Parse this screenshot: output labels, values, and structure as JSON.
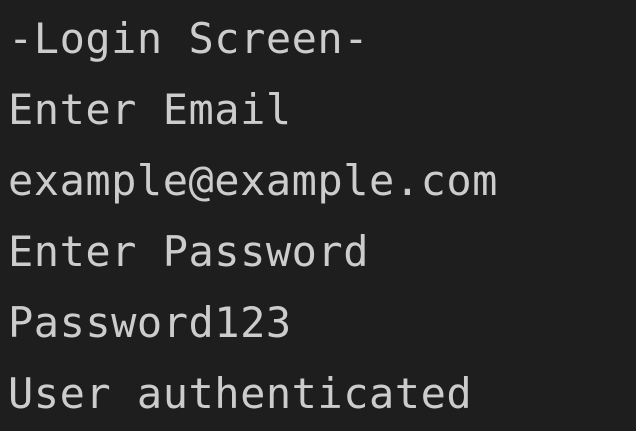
{
  "terminal": {
    "lines": [
      "-Login Screen-",
      "Enter Email",
      "example@example.com",
      "Enter Password",
      "Password123",
      "User authenticated"
    ]
  },
  "colors": {
    "background": "#1e1e1e",
    "text": "#cccccc"
  }
}
